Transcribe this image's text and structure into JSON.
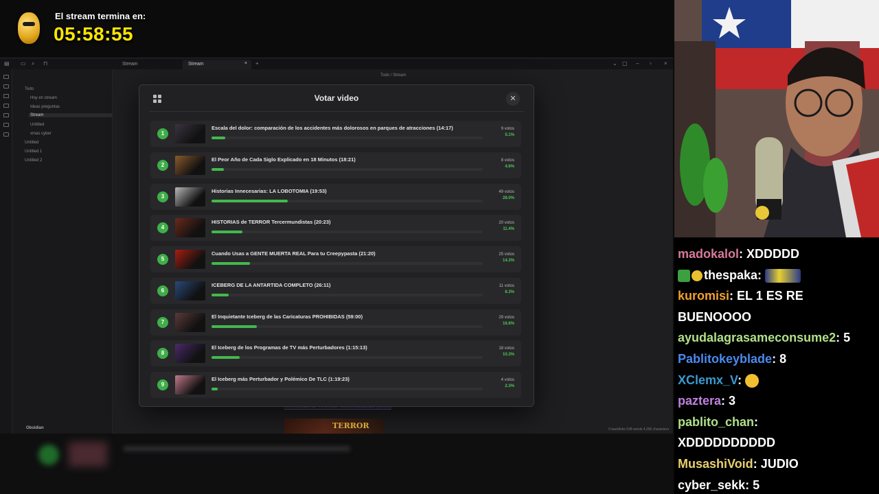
{
  "timer": {
    "label": "El stream termina en:",
    "time": "05:58:55"
  },
  "obsidian": {
    "tabs": [
      "Stream",
      "Stream"
    ],
    "breadcrumb": "Todo / Stream",
    "explorer": {
      "root": "Todo",
      "items": [
        "Hoy en stream",
        "Ideas preguntas",
        "Stream",
        "Untitled",
        "xmas cyber"
      ],
      "others": [
        "Untitled",
        "Untitled 1",
        "Untitled 2"
      ],
      "vault": "Obsidian"
    },
    "status": "0 backlinks   538 words  4,365 characters"
  },
  "modal": {
    "title": "Votar video",
    "rows": [
      {
        "num": "1",
        "title": "Escala del dolor: comparación de los accidentes más dolorosos en parques de atracciones (14:17)",
        "votes": "9 votos",
        "pct": "5.1%",
        "frac": 0.051,
        "thumb": "#3a3340"
      },
      {
        "num": "2",
        "title": "El Peor Año de Cada Siglo Explicado en 18 Minutos (18:21)",
        "votes": "8 votos",
        "pct": "4.6%",
        "frac": 0.046,
        "thumb": "#8a5a2a"
      },
      {
        "num": "3",
        "title": "Historias Innecesarias: LA LOBOTOMIA (19:53)",
        "votes": "49 votos",
        "pct": "28.0%",
        "frac": 0.28,
        "thumb": "#b8b8b8"
      },
      {
        "num": "4",
        "title": "HISTORIAS de TERROR Tercermundistas (20:23)",
        "votes": "20 votos",
        "pct": "11.4%",
        "frac": 0.114,
        "thumb": "#6a2a1a"
      },
      {
        "num": "5",
        "title": "Cuando Usas a GENTE MUERTA REAL Para tu Creepypasta (21:20)",
        "votes": "25 votos",
        "pct": "14.3%",
        "frac": 0.143,
        "thumb": "#a81e10"
      },
      {
        "num": "6",
        "title": "ICEBERG DE LA ANTARTIDA COMPLETO (26:11)",
        "votes": "11 votos",
        "pct": "6.3%",
        "frac": 0.063,
        "thumb": "#2a4a7a"
      },
      {
        "num": "7",
        "title": "El Inquietante Iceberg de las Caricaturas PROHIBIDAS (59:00)",
        "votes": "29 votos",
        "pct": "16.6%",
        "frac": 0.166,
        "thumb": "#5a3a3a"
      },
      {
        "num": "8",
        "title": "El Iceberg de los Programas de TV más Perturbadores (1:15:13)",
        "votes": "18 votos",
        "pct": "10.3%",
        "frac": 0.103,
        "thumb": "#4a2a6a"
      },
      {
        "num": "9",
        "title": "El Iceberg más Perturbador y Polémico De TLC (1:19:23)",
        "votes": "4 votos",
        "pct": "2.3%",
        "frac": 0.023,
        "thumb": "#c07a8a"
      }
    ]
  },
  "background": {
    "link": "HISTORIAS de TERROR Tercermundistas (20:23)",
    "thumb_text": "TERROR"
  },
  "chat": [
    {
      "user": "madokalol",
      "color": "#d77a9a",
      "text": "XDDDDD"
    },
    {
      "user": "thespaka",
      "color": "#ffffff",
      "text": ""
    },
    {
      "user": "kuromisi",
      "color": "#f0a030",
      "text": "EL 1 ES RE"
    },
    {
      "user": "",
      "color": "#ffffff",
      "text": "BUENOOOO"
    },
    {
      "user": "ayudalagrasameconsume2",
      "color": "#b0e08a",
      "text": "5"
    },
    {
      "user": "Pablitokeyblade",
      "color": "#4a8af0",
      "text": "8"
    },
    {
      "user": "XClemx_V",
      "color": "#3a9ad0",
      "text": ""
    },
    {
      "user": "paztera",
      "color": "#c080e0",
      "text": "3"
    },
    {
      "user": "pablito_chan",
      "color": "#b0e08a",
      "text": ""
    },
    {
      "user": "",
      "color": "#ffffff",
      "text": "XDDDDDDDDDD"
    },
    {
      "user": "MusashiVoid",
      "color": "#e8d070",
      "text": "JUDIO"
    },
    {
      "user": "cyber_sekk",
      "color": "#ffffff",
      "text": "5"
    }
  ]
}
